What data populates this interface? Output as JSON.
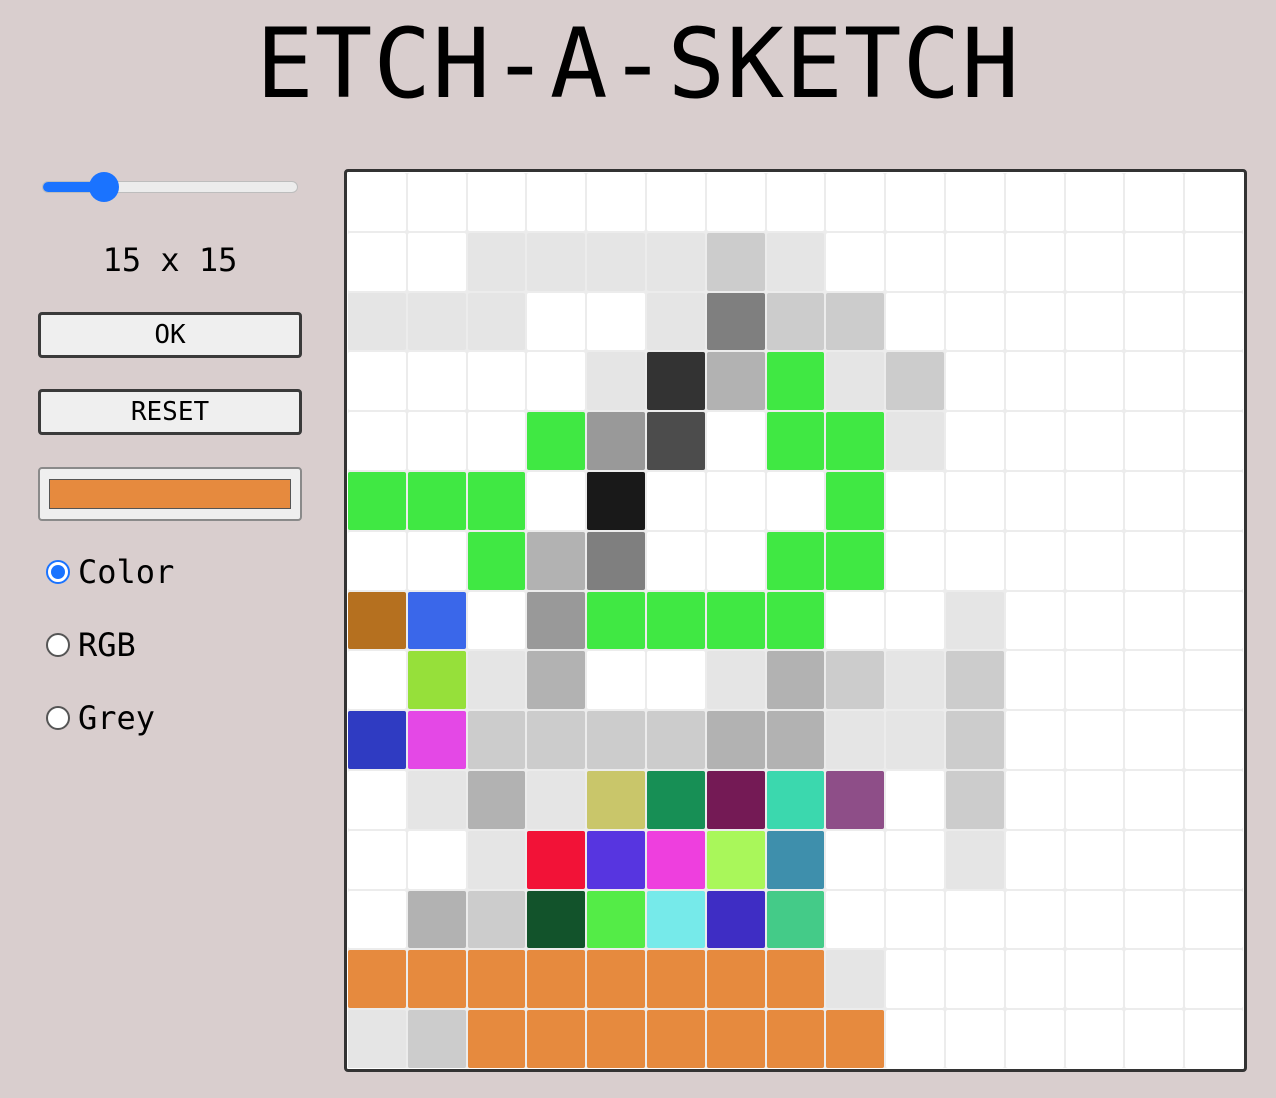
{
  "title": "ETCH-A-SKETCH",
  "controls": {
    "grid_size": 15,
    "slider_min": 2,
    "slider_max": 64,
    "grid_size_label": "15 x 15",
    "ok_label": "OK",
    "reset_label": "RESET",
    "current_color": "#e68a3e",
    "modes": [
      {
        "label": "Color",
        "checked": true
      },
      {
        "label": "RGB",
        "checked": false
      },
      {
        "label": "Grey",
        "checked": false
      }
    ]
  },
  "board": {
    "rows": 15,
    "cols": 15,
    "cells": [
      [
        "#ffffff",
        "#ffffff",
        "#ffffff",
        "#ffffff",
        "#ffffff",
        "#ffffff",
        "#ffffff",
        "#ffffff",
        "#ffffff",
        "#ffffff",
        "#ffffff",
        "#ffffff",
        "#ffffff",
        "#ffffff",
        "#ffffff"
      ],
      [
        "#ffffff",
        "#ffffff",
        "#e5e5e5",
        "#e5e5e5",
        "#e5e5e5",
        "#e5e5e5",
        "#cccccc",
        "#e5e5e5",
        "#ffffff",
        "#ffffff",
        "#ffffff",
        "#ffffff",
        "#ffffff",
        "#ffffff",
        "#ffffff"
      ],
      [
        "#e5e5e5",
        "#e5e5e5",
        "#e5e5e5",
        "#ffffff",
        "#ffffff",
        "#e5e5e5",
        "#7f7f7f",
        "#cccccc",
        "#cccccc",
        "#ffffff",
        "#ffffff",
        "#ffffff",
        "#ffffff",
        "#ffffff",
        "#ffffff"
      ],
      [
        "#ffffff",
        "#ffffff",
        "#ffffff",
        "#ffffff",
        "#e5e5e5",
        "#333333",
        "#b2b2b2",
        "#40e843",
        "#e5e5e5",
        "#cccccc",
        "#ffffff",
        "#ffffff",
        "#ffffff",
        "#ffffff",
        "#ffffff"
      ],
      [
        "#ffffff",
        "#ffffff",
        "#ffffff",
        "#40e843",
        "#999999",
        "#4c4c4c",
        "#ffffff",
        "#40e843",
        "#40e843",
        "#e5e5e5",
        "#ffffff",
        "#ffffff",
        "#ffffff",
        "#ffffff",
        "#ffffff"
      ],
      [
        "#40e843",
        "#40e843",
        "#40e843",
        "#ffffff",
        "#191919",
        "#ffffff",
        "#ffffff",
        "#ffffff",
        "#40e843",
        "#ffffff",
        "#ffffff",
        "#ffffff",
        "#ffffff",
        "#ffffff",
        "#ffffff"
      ],
      [
        "#ffffff",
        "#ffffff",
        "#40e843",
        "#b2b2b2",
        "#7f7f7f",
        "#ffffff",
        "#ffffff",
        "#40e843",
        "#40e843",
        "#ffffff",
        "#ffffff",
        "#ffffff",
        "#ffffff",
        "#ffffff",
        "#ffffff"
      ],
      [
        "#b5701f",
        "#3a67ea",
        "#ffffff",
        "#999999",
        "#40e843",
        "#40e843",
        "#40e843",
        "#40e843",
        "#ffffff",
        "#ffffff",
        "#e5e5e5",
        "#ffffff",
        "#ffffff",
        "#ffffff",
        "#ffffff"
      ],
      [
        "#ffffff",
        "#96e03a",
        "#e5e5e5",
        "#b2b2b2",
        "#ffffff",
        "#ffffff",
        "#e5e5e5",
        "#b2b2b2",
        "#cccccc",
        "#e5e5e5",
        "#cccccc",
        "#ffffff",
        "#ffffff",
        "#ffffff",
        "#ffffff"
      ],
      [
        "#2f3bc2",
        "#e448e6",
        "#cccccc",
        "#cccccc",
        "#cccccc",
        "#cccccc",
        "#b2b2b2",
        "#b2b2b2",
        "#e5e5e5",
        "#e5e5e5",
        "#cccccc",
        "#ffffff",
        "#ffffff",
        "#ffffff",
        "#ffffff"
      ],
      [
        "#ffffff",
        "#e5e5e5",
        "#b2b2b2",
        "#e5e5e5",
        "#c9c66a",
        "#178f55",
        "#741a55",
        "#3bd8ae",
        "#8e4e88",
        "#ffffff",
        "#cccccc",
        "#ffffff",
        "#ffffff",
        "#ffffff",
        "#ffffff"
      ],
      [
        "#ffffff",
        "#ffffff",
        "#e5e5e5",
        "#f21237",
        "#5735e0",
        "#ee3fde",
        "#a9f75a",
        "#3e8fac",
        "#ffffff",
        "#ffffff",
        "#e5e5e5",
        "#ffffff",
        "#ffffff",
        "#ffffff",
        "#ffffff"
      ],
      [
        "#ffffff",
        "#b2b2b2",
        "#cccccc",
        "#12532b",
        "#54ec47",
        "#76eaea",
        "#3e2dc4",
        "#44cb88",
        "#ffffff",
        "#ffffff",
        "#ffffff",
        "#ffffff",
        "#ffffff",
        "#ffffff",
        "#ffffff"
      ],
      [
        "#e68a3e",
        "#e68a3e",
        "#e68a3e",
        "#e68a3e",
        "#e68a3e",
        "#e68a3e",
        "#e68a3e",
        "#e68a3e",
        "#e5e5e5",
        "#ffffff",
        "#ffffff",
        "#ffffff",
        "#ffffff",
        "#ffffff",
        "#ffffff"
      ],
      [
        "#e5e5e5",
        "#cccccc",
        "#e68a3e",
        "#e68a3e",
        "#e68a3e",
        "#e68a3e",
        "#e68a3e",
        "#e68a3e",
        "#e68a3e",
        "#ffffff",
        "#ffffff",
        "#ffffff",
        "#ffffff",
        "#ffffff",
        "#ffffff"
      ]
    ]
  },
  "colors": {
    "background": "#d9cece",
    "accent": "#1a73ff"
  }
}
